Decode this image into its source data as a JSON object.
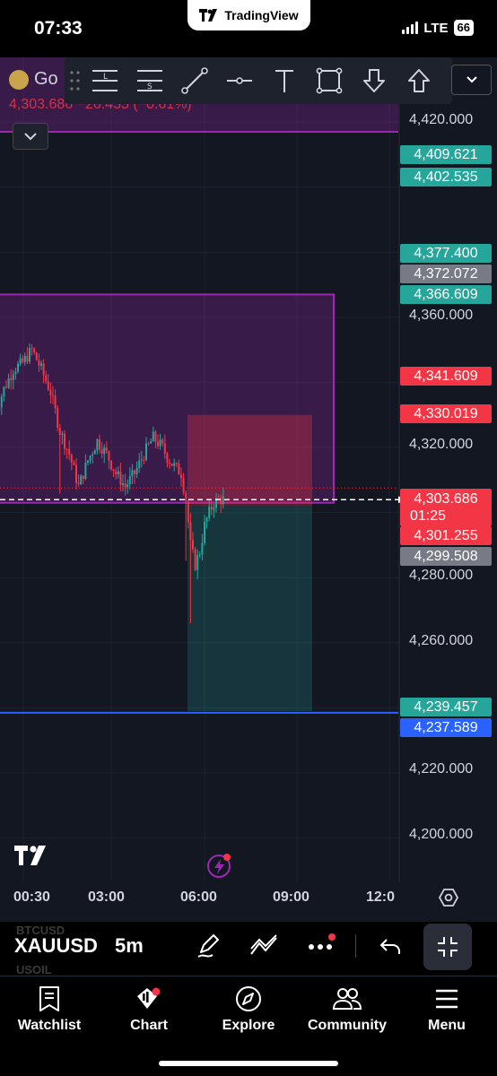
{
  "status": {
    "time": "07:33",
    "network": "LTE",
    "battery": "66"
  },
  "app_pill": {
    "label": "TradingView"
  },
  "header": {
    "symbol": "Go",
    "price_line": {
      "last": "4,303.686",
      "change": "−26.455",
      "percent": "(−0.61%)"
    }
  },
  "drawing_toolbar": {
    "tools": [
      {
        "name": "long-position-tool",
        "icon": "ruler-l",
        "letter": "L"
      },
      {
        "name": "short-position-tool",
        "icon": "ruler-s",
        "letter": "S"
      },
      {
        "name": "trend-line-tool",
        "icon": "trend-line"
      },
      {
        "name": "horizontal-ray-tool",
        "icon": "horizontal-line"
      },
      {
        "name": "text-tool",
        "icon": "text-T"
      },
      {
        "name": "rectangle-tool",
        "icon": "rectangle"
      },
      {
        "name": "arrow-down-tool",
        "icon": "arrow-down"
      },
      {
        "name": "arrow-up-tool",
        "icon": "arrow-up"
      }
    ]
  },
  "price_axis": {
    "ticks": [
      "4,420.000",
      "4,360.000",
      "4,320.000",
      "4,280.000",
      "4,260.000",
      "4,220.000",
      "4,200.000"
    ],
    "badges": [
      {
        "text": "4,409.621",
        "color": "#26a69a"
      },
      {
        "text": "4,402.535",
        "color": "#26a69a"
      },
      {
        "text": "4,377.400",
        "color": "#26a69a"
      },
      {
        "text": "4,372.072",
        "color": "#787b86"
      },
      {
        "text": "4,366.609",
        "color": "#26a69a"
      },
      {
        "text": "4,341.609",
        "color": "#f23645"
      },
      {
        "text": "4,330.019",
        "color": "#f23645"
      },
      {
        "text": "4,301.255",
        "color": "#f23645"
      },
      {
        "text": "4,299.508",
        "color": "#787b86"
      },
      {
        "text": "4,239.457",
        "color": "#26a69a"
      },
      {
        "text": "4,237.589",
        "color": "#2962ff"
      }
    ],
    "last_price": {
      "price": "4,303.686",
      "countdown": "01:25",
      "color": "#f23645"
    }
  },
  "time_axis": {
    "labels": [
      "00:30",
      "03:00",
      "06:00",
      "09:00",
      "12:0"
    ]
  },
  "bottom_toolbar": {
    "symbol": "XAUUSD",
    "interval": "5m",
    "ghost_above": "BTCUSD",
    "ghost_below": "USOIL"
  },
  "tabs": [
    {
      "label": "Watchlist",
      "icon": "watchlist-icon"
    },
    {
      "label": "Chart",
      "icon": "chart-icon"
    },
    {
      "label": "Explore",
      "icon": "compass-icon"
    },
    {
      "label": "Community",
      "icon": "people-icon"
    },
    {
      "label": "Menu",
      "icon": "hamburger-icon"
    }
  ],
  "colors": {
    "background": "#131722",
    "bull": "#26a69a",
    "bear": "#f23645",
    "zone_purple": "#9c27b0",
    "blue_line": "#2962ff"
  },
  "chart_data": {
    "type": "candlestick",
    "symbol": "XAUUSD",
    "interval": "5m",
    "y_range": [
      4190,
      4430
    ],
    "price_path": [
      [
        0,
        4330
      ],
      [
        4,
        4338
      ],
      [
        8,
        4344
      ],
      [
        12,
        4346
      ],
      [
        16,
        4350
      ],
      [
        18,
        4347
      ],
      [
        20,
        4344
      ],
      [
        24,
        4337
      ],
      [
        28,
        4325
      ],
      [
        32,
        4318
      ],
      [
        36,
        4308
      ],
      [
        40,
        4316
      ],
      [
        44,
        4322
      ],
      [
        48,
        4318
      ],
      [
        52,
        4312
      ],
      [
        56,
        4308
      ],
      [
        60,
        4312
      ],
      [
        64,
        4318
      ],
      [
        68,
        4323
      ],
      [
        72,
        4320
      ],
      [
        74,
        4317
      ],
      [
        76,
        4315
      ],
      [
        80,
        4312
      ],
      [
        82,
        4304
      ],
      [
        84,
        4290
      ],
      [
        86,
        4284
      ],
      [
        88,
        4288
      ],
      [
        90,
        4296
      ],
      [
        92,
        4300
      ],
      [
        94,
        4303
      ],
      [
        96,
        4304
      ],
      [
        98,
        4304
      ]
    ],
    "levels": [
      {
        "price": 4422,
        "label": "purple top line"
      },
      {
        "price": 4303.686,
        "label": "last price"
      },
      {
        "price": 4238.5,
        "label": "blue line"
      }
    ],
    "zone": {
      "top": 4367,
      "bottom": 4303
    },
    "position": {
      "entry": 4302,
      "stop": 4330,
      "target": 4239
    }
  }
}
